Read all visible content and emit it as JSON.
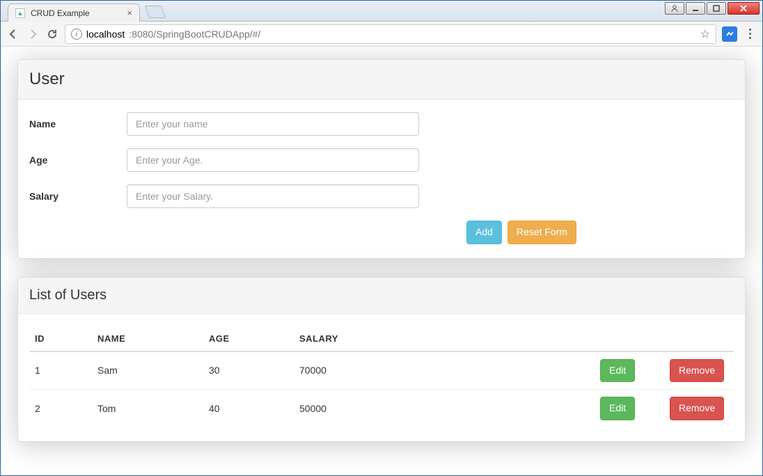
{
  "window": {
    "tab_title": "CRUD Example"
  },
  "browser": {
    "url_host": "localhost",
    "url_rest": ":8080/SpringBootCRUDApp/#/"
  },
  "form": {
    "heading": "User",
    "name_label": "Name",
    "name_placeholder": "Enter your name",
    "age_label": "Age",
    "age_placeholder": "Enter your Age.",
    "salary_label": "Salary",
    "salary_placeholder": "Enter your Salary.",
    "add_label": "Add",
    "reset_label": "Reset Form"
  },
  "list": {
    "heading": "List of Users",
    "columns": {
      "id": "ID",
      "name": "NAME",
      "age": "AGE",
      "salary": "SALARY"
    },
    "edit_label": "Edit",
    "remove_label": "Remove",
    "rows": [
      {
        "id": "1",
        "name": "Sam",
        "age": "30",
        "salary": "70000"
      },
      {
        "id": "2",
        "name": "Tom",
        "age": "40",
        "salary": "50000"
      }
    ]
  }
}
